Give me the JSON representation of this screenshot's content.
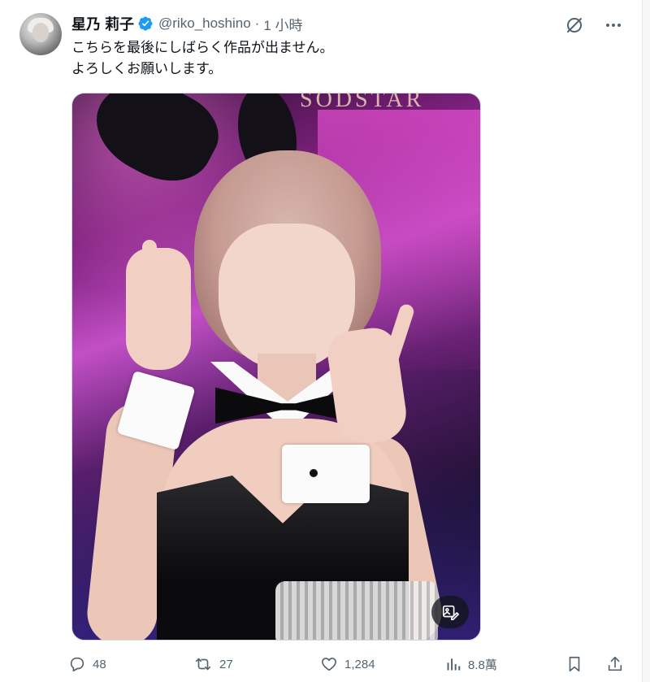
{
  "author": {
    "display_name": "星乃 莉子",
    "handle": "@riko_hoshino",
    "separator": "·",
    "time": "1 小時",
    "avatar_icon": "avatar"
  },
  "tweet": {
    "lines": [
      "こちらを最後にしばらく作品が出ません。",
      "よろしくお願いします。"
    ]
  },
  "media": {
    "brand_text": "SODSTAR",
    "alt_icon": "image-edit-icon"
  },
  "actions": {
    "reply_count": "48",
    "retweet_count": "27",
    "like_count": "1,284",
    "views_count": "8.8萬"
  },
  "colors": {
    "verified": "#1d9bf0",
    "muted": "#536471",
    "text": "#0f1419"
  }
}
